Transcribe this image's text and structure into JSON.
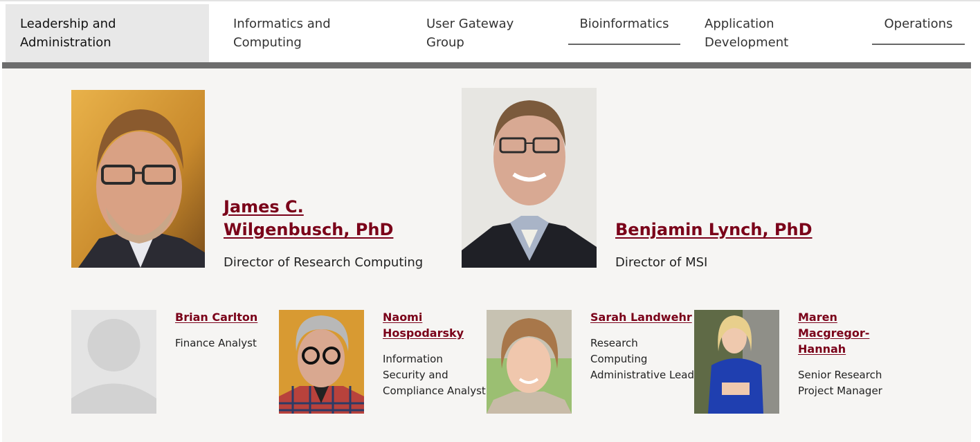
{
  "tabs": [
    {
      "label": "Leadership and Administration",
      "active": true
    },
    {
      "label": "Informatics and Computing"
    },
    {
      "label": "User Gateway Group"
    },
    {
      "label": "Bioinformatics"
    },
    {
      "label": "Application Development"
    },
    {
      "label": "Operations"
    }
  ],
  "leaders": [
    {
      "name": "James C. Wilgenbusch, PhD",
      "title": "Director of Research Computing"
    },
    {
      "name": "Benjamin Lynch, PhD",
      "title": "Director of MSI"
    }
  ],
  "staff": [
    {
      "name": "Brian Carlton",
      "title": "Finance Analyst"
    },
    {
      "name": "Naomi Hospodarsky",
      "title": "Information Security and Compliance Analyst"
    },
    {
      "name": "Sarah Landwehr",
      "title": "Research Computing Administrative Lead"
    },
    {
      "name": "Maren Macgregor-Hannah",
      "title": "Senior Research Project Manager"
    }
  ],
  "colors": {
    "accent": "#7a0019",
    "panel": "#f6f5f3",
    "tab_active": "#e8e8e8",
    "bar": "#6d6d6d"
  },
  "icons": {
    "placeholder_photo": "person-silhouette-icon"
  }
}
